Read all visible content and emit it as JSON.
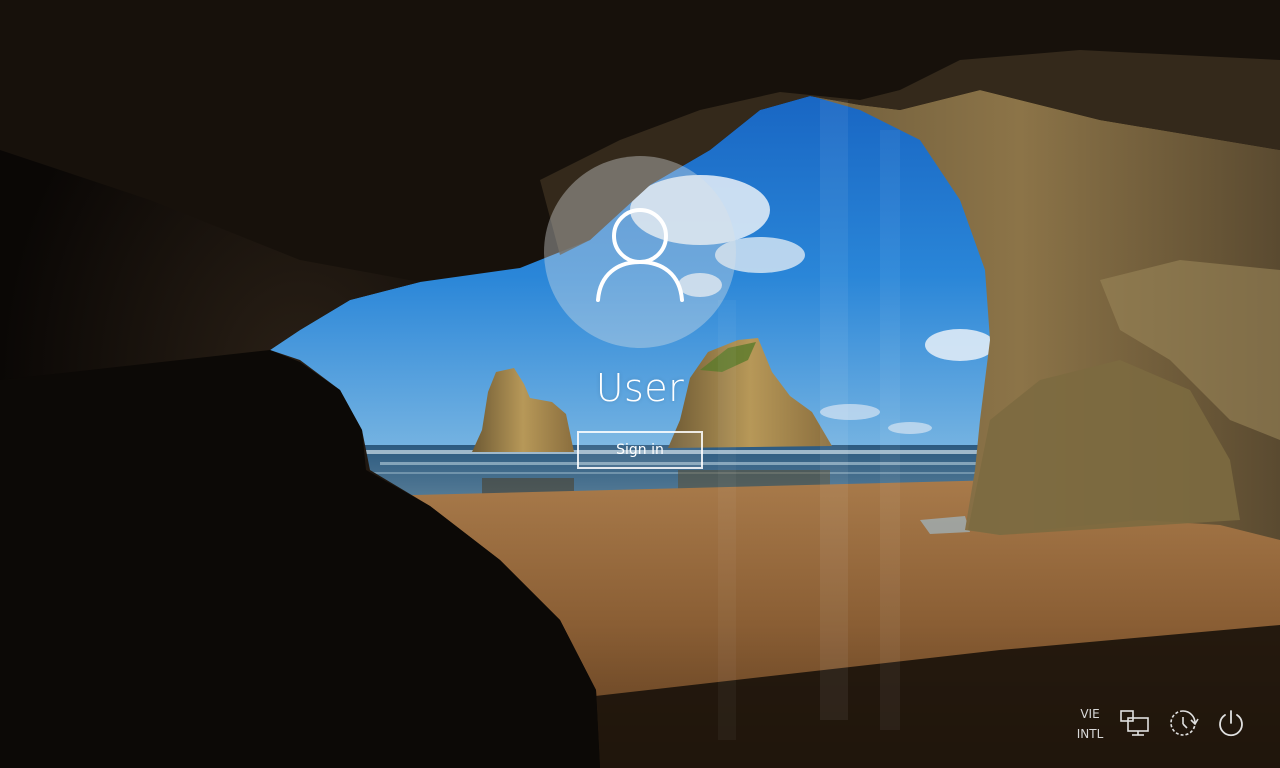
{
  "lock_screen": {
    "username": "User",
    "sign_in_label": "Sign in"
  },
  "tray": {
    "language_line1": "VIE",
    "language_line2": "INTL",
    "icons": [
      "network-icon",
      "ease-of-access-icon",
      "power-icon"
    ]
  },
  "colors": {
    "sky": "#1f6fc4",
    "sea": "#2a5f86",
    "sand": "#9a6b3c",
    "cave_rock": "#120d09",
    "text": "#ffffff"
  }
}
